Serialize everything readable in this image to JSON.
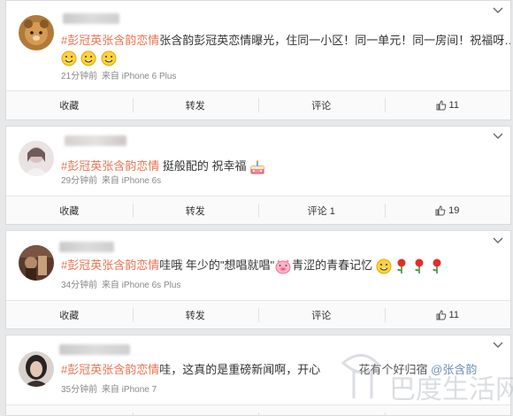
{
  "posts": [
    {
      "topic": "#彭冠英张含韵恋情",
      "text": "张含韵彭冠英恋情曝光，住同一小区！同一单元！同一房间！祝福呀……",
      "meta_time": "21分钟前",
      "meta_source": "来自 iPhone 6 Plus",
      "actions": {
        "collect": "收藏",
        "repost": "转发",
        "comment": "评论",
        "likes": "11"
      }
    },
    {
      "topic": "#彭冠英张含韵恋情",
      "text": "挺般配的 祝幸福",
      "meta_time": "29分钟前",
      "meta_source": "来自 iPhone 6s",
      "actions": {
        "collect": "收藏",
        "repost": "转发",
        "comment": "评论 1",
        "likes": "19"
      }
    },
    {
      "topic": "#彭冠英张含韵恋情",
      "text_a": "哇哦 年少的\"想唱就唱\"",
      "text_b": "青涩的青春记忆",
      "meta_time": "34分钟前",
      "meta_source": "来自 iPhone 6s Plus",
      "actions": {
        "collect": "收藏",
        "repost": "转发",
        "comment": "评论",
        "likes": "11"
      }
    },
    {
      "topic": "#彭冠英张含韵恋情",
      "text": "哇，这真的是重磅新闻啊，开心",
      "text_tail": "花有个好归宿",
      "mention": "@张含韵",
      "meta_time": "35分钟前",
      "meta_source": "来自 iPhone 7"
    }
  ],
  "icons": {
    "chevron": "chevron-down-icon",
    "like": "thumbs-up-icon",
    "emoji_smile": "smile-emoji-icon",
    "emoji_cake": "cake-emoji-icon",
    "emoji_pig": "pig-emoji-icon",
    "emoji_rose": "rose-emoji-icon"
  },
  "colors": {
    "topic": "#eb7350",
    "text": "#333333",
    "meta": "#888888"
  },
  "watermark_text": "巴度生活网"
}
